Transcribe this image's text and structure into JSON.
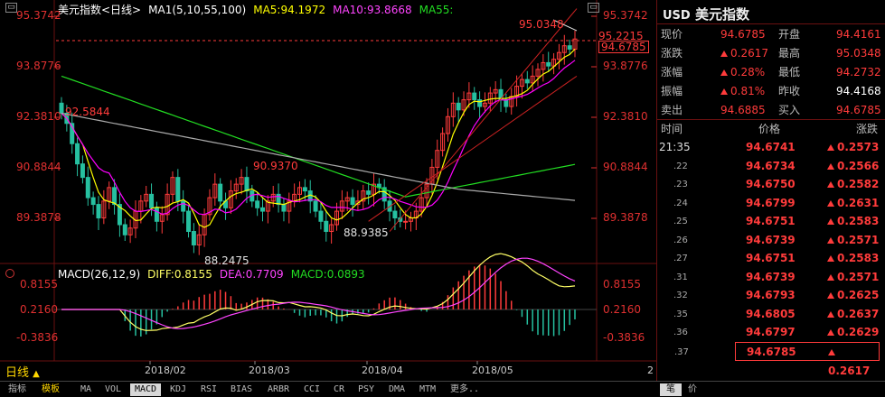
{
  "header": {
    "title": "美元指数<日线>",
    "ma_label": "MA1(5,10,55,100)",
    "ma5": "MA5:94.1972",
    "ma10": "MA10:93.8668",
    "ma55": "MA55:"
  },
  "price_axis": {
    "left": [
      "95.3742",
      "93.8776",
      "92.3810",
      "90.8844",
      "89.3878"
    ],
    "right": [
      "95.3742",
      "93.8776",
      "92.3810",
      "90.8844",
      "89.3878"
    ],
    "current_tag_1": "95.2215",
    "current_tag_2": "94.6785"
  },
  "annotations": {
    "high_label": "95.0348",
    "a1": "92.5844",
    "a2": "90.9370",
    "a3": "88.9385",
    "a4": "88.2475"
  },
  "macd": {
    "label": "MACD(26,12,9)",
    "diff": "DIFF:0.8155",
    "dea": "DEA:0.7709",
    "macd": "MACD:0.0893",
    "axis": [
      "0.8155",
      "0.2160",
      "-0.3836"
    ]
  },
  "x_axis": [
    "2018/02",
    "2018/03",
    "2018/04",
    "2018/05"
  ],
  "period": {
    "label": "日线",
    "page_num": "2"
  },
  "tabs": [
    "指标",
    "模板",
    "MA",
    "VOL",
    "MACD",
    "KDJ",
    "RSI",
    "BIAS",
    "ARBR",
    "CCI",
    "CR",
    "PSY",
    "DMA",
    "MTM",
    "更多.."
  ],
  "tab_active": "MACD",
  "bottom_right": {
    "a": "笔",
    "b": "价"
  },
  "panel": {
    "code": "USD",
    "name": "美元指数",
    "quote": {
      "xianjia": {
        "label": "现价",
        "value": "94.6785"
      },
      "kaipan": {
        "label": "开盘",
        "value": "94.4161"
      },
      "zhangdie": {
        "label": "涨跌",
        "value": "0.2617"
      },
      "zuigao": {
        "label": "最高",
        "value": "95.0348"
      },
      "zhangfu": {
        "label": "涨幅",
        "value": "0.28%"
      },
      "zuidi": {
        "label": "最低",
        "value": "94.2732"
      },
      "zhenfu": {
        "label": "振幅",
        "value": "0.81%"
      },
      "zuoshou": {
        "label": "昨收",
        "value": "94.4168"
      },
      "maichu": {
        "label": "卖出",
        "value": "94.6885"
      },
      "mairu": {
        "label": "买入",
        "value": "94.6785"
      }
    },
    "ticks_header": {
      "time": "时间",
      "price": "价格",
      "change": "涨跌"
    },
    "ticks": [
      {
        "time": "21:35",
        "price": "94.6741",
        "change": "0.2573"
      },
      {
        "time": ".22",
        "price": "94.6734",
        "change": "0.2566"
      },
      {
        "time": ".23",
        "price": "94.6750",
        "change": "0.2582"
      },
      {
        "time": ".24",
        "price": "94.6799",
        "change": "0.2631"
      },
      {
        "time": ".25",
        "price": "94.6751",
        "change": "0.2583"
      },
      {
        "time": ".26",
        "price": "94.6739",
        "change": "0.2571"
      },
      {
        "time": ".27",
        "price": "94.6751",
        "change": "0.2583"
      },
      {
        "time": ".31",
        "price": "94.6739",
        "change": "0.2571"
      },
      {
        "time": ".32",
        "price": "94.6793",
        "change": "0.2625"
      },
      {
        "time": ".35",
        "price": "94.6805",
        "change": "0.2637"
      },
      {
        "time": ".36",
        "price": "94.6797",
        "change": "0.2629"
      },
      {
        "time": ".37",
        "price": "94.6785",
        "change": "0.2617"
      }
    ]
  },
  "colors": {
    "up": "#ff3b3b",
    "down": "#26c0a0",
    "ma5": "#ffff00",
    "ma10": "#ff00ff",
    "ma55": "#22dd22",
    "ma100": "#aaaaaa",
    "diff": "#ffff66",
    "dea": "#ff44ff",
    "background": "#000000"
  }
}
